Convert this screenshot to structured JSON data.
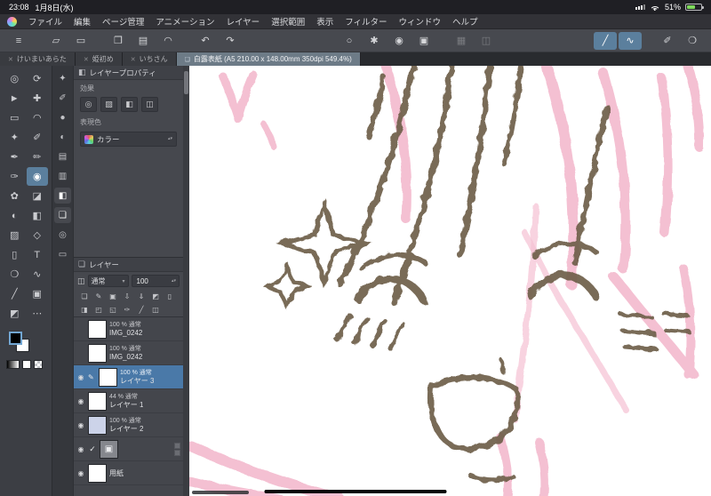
{
  "status_bar": {
    "time": "23:08",
    "date": "1月8日(水)",
    "battery_percent": "51%"
  },
  "menu_bar": {
    "items": [
      "ファイル",
      "編集",
      "ページ管理",
      "アニメーション",
      "レイヤー",
      "選択範囲",
      "表示",
      "フィルター",
      "ウィンドウ",
      "ヘルプ"
    ]
  },
  "toolbar": {
    "icons": [
      {
        "name": "hamburger-menu",
        "glyph": "≡"
      },
      {
        "name": "object-tool",
        "glyph": "▱"
      },
      {
        "name": "marquee-tool",
        "glyph": "▭"
      },
      {
        "name": "paste-image",
        "glyph": "❐"
      },
      {
        "name": "import-file",
        "glyph": "▤"
      },
      {
        "name": "cloud-sync",
        "glyph": "◠"
      },
      {
        "name": "undo",
        "glyph": "↶"
      },
      {
        "name": "redo",
        "glyph": "↷"
      },
      {
        "name": "deselect",
        "glyph": "○"
      },
      {
        "name": "settings-gear",
        "glyph": "✱"
      },
      {
        "name": "brush-settings",
        "glyph": "◉"
      },
      {
        "name": "crop",
        "glyph": "▣"
      },
      {
        "name": "grid-view",
        "glyph": "▦"
      },
      {
        "name": "material-panel",
        "glyph": "◫"
      },
      {
        "name": "straight-line-tool",
        "glyph": "╱"
      },
      {
        "name": "curve-tool",
        "glyph": "∿"
      },
      {
        "name": "eyedropper-toolbar",
        "glyph": "✐"
      },
      {
        "name": "feedback-chat",
        "glyph": "❍"
      }
    ]
  },
  "tab_bar": {
    "tabs": [
      {
        "label": "けいまいあらた"
      },
      {
        "label": "姫初め"
      },
      {
        "label": "いちさん"
      }
    ],
    "active_tab": {
      "label": "白露表紙 (A5 210.00 x 148.00mm 350dpi 549.4%)"
    }
  },
  "ui_glyphs": {
    "close": "✕",
    "caret_down": "▾",
    "stepper": "▴▾",
    "tab_icon": "❏"
  },
  "tools": [
    {
      "name": "zoom",
      "glyph": "◎"
    },
    {
      "name": "rotate-canvas",
      "glyph": "⟳"
    },
    {
      "name": "operation",
      "glyph": "►"
    },
    {
      "name": "move",
      "glyph": "✚"
    },
    {
      "name": "marquee-select",
      "glyph": "▭"
    },
    {
      "name": "lasso-select",
      "glyph": "◠"
    },
    {
      "name": "auto-select",
      "glyph": "✦"
    },
    {
      "name": "eyedropper",
      "glyph": "✐"
    },
    {
      "name": "pen",
      "glyph": "✒"
    },
    {
      "name": "pencil",
      "glyph": "✏"
    },
    {
      "name": "brush",
      "glyph": "✑"
    },
    {
      "name": "airbrush",
      "glyph": "◉"
    },
    {
      "name": "decoration",
      "glyph": "✿"
    },
    {
      "name": "eraser",
      "glyph": "◪"
    },
    {
      "name": "blend",
      "glyph": "◐"
    },
    {
      "name": "fill",
      "glyph": "◧"
    },
    {
      "name": "gradient",
      "glyph": "▨"
    },
    {
      "name": "figure",
      "glyph": "◇"
    },
    {
      "name": "frame-border",
      "glyph": "▯"
    },
    {
      "name": "text",
      "glyph": "T"
    },
    {
      "name": "balloon",
      "glyph": "❍"
    },
    {
      "name": "line-correction",
      "glyph": "∿"
    },
    {
      "name": "ruler",
      "glyph": "╱"
    },
    {
      "name": "material",
      "glyph": "▣"
    },
    {
      "name": "selection-launcher",
      "glyph": "◩"
    },
    {
      "name": "more-tools",
      "glyph": "⋯"
    }
  ],
  "panel_strip": [
    {
      "name": "quick-access",
      "glyph": "✦"
    },
    {
      "name": "sub-tool",
      "glyph": "✐"
    },
    {
      "name": "brush-size",
      "glyph": "●"
    },
    {
      "name": "color-wheel",
      "glyph": "◐"
    },
    {
      "name": "color-set",
      "glyph": "▤"
    },
    {
      "name": "color-slider",
      "glyph": "▥"
    },
    {
      "name": "layer-property-tab",
      "glyph": "◧"
    },
    {
      "name": "layer-tab",
      "glyph": "❏"
    },
    {
      "name": "navigator",
      "glyph": "◎"
    },
    {
      "name": "timeline",
      "glyph": "▭"
    }
  ],
  "layer_property": {
    "title": "レイヤープロパティ",
    "effect_label": "効果",
    "effect_icons": [
      {
        "name": "border-effect",
        "glyph": "◎"
      },
      {
        "name": "tone-effect",
        "glyph": "▨"
      },
      {
        "name": "layer-color-effect",
        "glyph": "◧"
      },
      {
        "name": "expression-color-effect",
        "glyph": "◫"
      }
    ],
    "expression_label": "表現色",
    "expression_value": "カラー"
  },
  "layer_panel": {
    "title": "レイヤー",
    "blend_mode": "通常",
    "opacity_value": "100",
    "toolbar_row1": [
      {
        "name": "new-raster-layer",
        "glyph": "❏"
      },
      {
        "name": "new-vector-layer",
        "glyph": "✎"
      },
      {
        "name": "new-folder",
        "glyph": "▣"
      },
      {
        "name": "transfer-down",
        "glyph": "⇩"
      },
      {
        "name": "merge-down",
        "glyph": "⇓"
      },
      {
        "name": "layer-mask",
        "glyph": "◩"
      },
      {
        "name": "delete-layer",
        "glyph": "▯"
      }
    ],
    "toolbar_row2": [
      {
        "name": "clip-to-below",
        "glyph": "◨"
      },
      {
        "name": "lock-layer",
        "glyph": "◰"
      },
      {
        "name": "lock-transparency",
        "glyph": "◱"
      },
      {
        "name": "set-as-draft",
        "glyph": "✑"
      },
      {
        "name": "enable-ruler",
        "glyph": "╱"
      },
      {
        "name": "two-pane-view",
        "glyph": "◫"
      }
    ],
    "layers": [
      {
        "eye": "",
        "edit": "",
        "info": "100 % 通常",
        "name": "IMG_0242",
        "thumb": "checker"
      },
      {
        "eye": "",
        "edit": "",
        "info": "100 % 通常",
        "name": "IMG_0242",
        "thumb": "checker"
      },
      {
        "eye": "◉",
        "edit": "✎",
        "info": "100 % 通常",
        "name": "レイヤー 3",
        "thumb": "checker"
      },
      {
        "eye": "◉",
        "edit": "",
        "info": "44 % 通常",
        "name": "レイヤー 1",
        "thumb": "checker"
      },
      {
        "eye": "◉",
        "edit": "",
        "info": "100 % 通常",
        "name": "レイヤー 2",
        "thumb": "blue"
      },
      {
        "eye": "◉",
        "edit": "",
        "check": "✓",
        "info": "",
        "name": "",
        "thumb": "folder",
        "folder_glyph": "▣"
      },
      {
        "eye": "◉",
        "edit": "",
        "info": "",
        "name": "用紙",
        "thumb": "white"
      }
    ]
  },
  "canvas": {
    "colors": {
      "pink": "#f3b9cd",
      "brown": "#6e5f4a"
    }
  }
}
